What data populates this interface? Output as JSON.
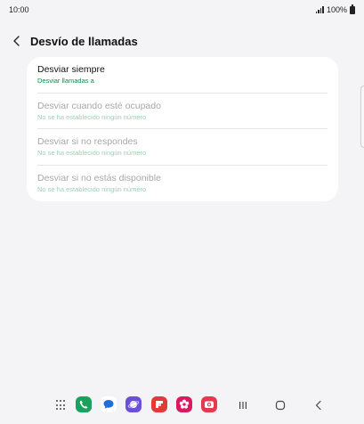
{
  "status_bar": {
    "time": "10:00",
    "battery": "100%"
  },
  "header": {
    "title": "Desvío de llamadas"
  },
  "options": [
    {
      "title": "Desviar siempre",
      "subtitle": "Desviar llamadas a",
      "enabled": true
    },
    {
      "title": "Desviar cuando esté ocupado",
      "subtitle": "No se ha establecido ningún número",
      "enabled": false
    },
    {
      "title": "Desviar si no respondes",
      "subtitle": "No se ha establecido ningún número",
      "enabled": false
    },
    {
      "title": "Desviar si no estás disponible",
      "subtitle": "No se ha establecido ningún número",
      "enabled": false
    }
  ],
  "dock_icons": [
    "phone-icon",
    "messages-icon",
    "internet-icon",
    "flipboard-icon",
    "blossom-icon",
    "camera-icon"
  ],
  "colors": {
    "accent_green": "#128a4a",
    "background": "#f4f4f7",
    "card": "#ffffff",
    "phone": "#1aa15e",
    "messages": "#1f6fd6",
    "internet": "#6b4fd8",
    "flipboard": "#e53935",
    "blossom": "#d81b60",
    "camera": "#e53950"
  }
}
